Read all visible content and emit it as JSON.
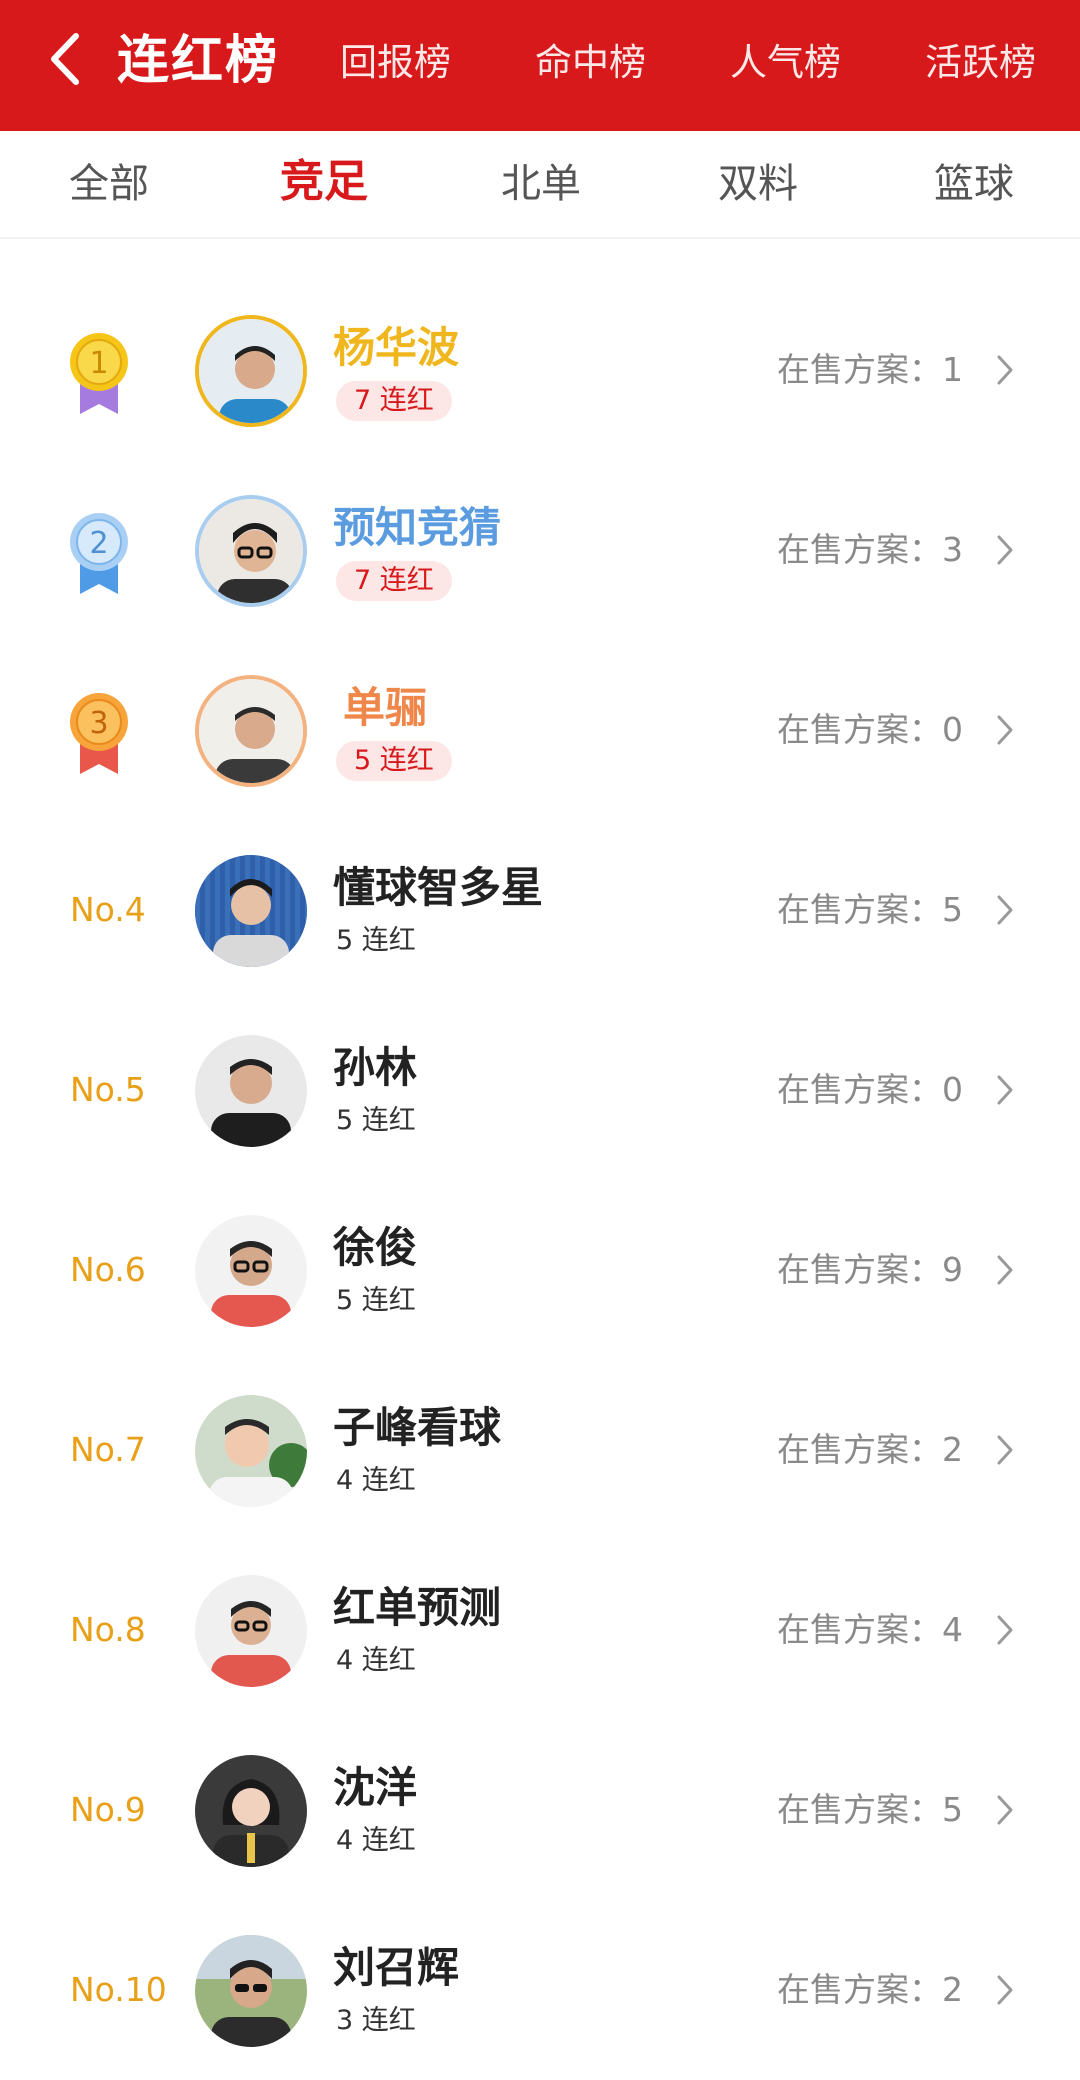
{
  "header": {
    "title": "连红榜",
    "tabs": [
      "回报榜",
      "命中榜",
      "人气榜",
      "活跃榜"
    ]
  },
  "sub_tabs": {
    "items": [
      "全部",
      "竞足",
      "北单",
      "双料",
      "篮球"
    ],
    "active": "竞足"
  },
  "colors": {
    "brand_red": "#d8191b",
    "gold": "#f0b61e",
    "silver_blue": "#5b9be0",
    "bronze_orange": "#f0874a",
    "rank_text": "#e8a018"
  },
  "ranking": [
    {
      "rank": "1",
      "medal": "gold",
      "name": "杨华波",
      "streak": "7 连红",
      "on_sale": "在售方案：1"
    },
    {
      "rank": "2",
      "medal": "silver",
      "name": "预知竞猜",
      "streak": "7 连红",
      "on_sale": "在售方案：3"
    },
    {
      "rank": "3",
      "medal": "bronze",
      "name": "单骊",
      "streak": "5 连红",
      "on_sale": "在售方案：0"
    },
    {
      "rank": "No.4",
      "name": "懂球智多星",
      "streak": "5 连红",
      "on_sale": "在售方案：5"
    },
    {
      "rank": "No.5",
      "name": "孙林",
      "streak": "5 连红",
      "on_sale": "在售方案：0"
    },
    {
      "rank": "No.6",
      "name": "徐俊",
      "streak": "5 连红",
      "on_sale": "在售方案：9"
    },
    {
      "rank": "No.7",
      "name": "子峰看球",
      "streak": "4 连红",
      "on_sale": "在售方案：2"
    },
    {
      "rank": "No.8",
      "name": "红单预测",
      "streak": "4 连红",
      "on_sale": "在售方案：4"
    },
    {
      "rank": "No.9",
      "name": "沈洋",
      "streak": "4 连红",
      "on_sale": "在售方案：5"
    },
    {
      "rank": "No.10",
      "name": "刘召辉",
      "streak": "3 连红",
      "on_sale": "在售方案：2"
    }
  ],
  "icons": {
    "back": "chevron-left-icon",
    "row_arrow": "chevron-right-icon",
    "medal": "medal-icon",
    "avatar": "avatar"
  }
}
